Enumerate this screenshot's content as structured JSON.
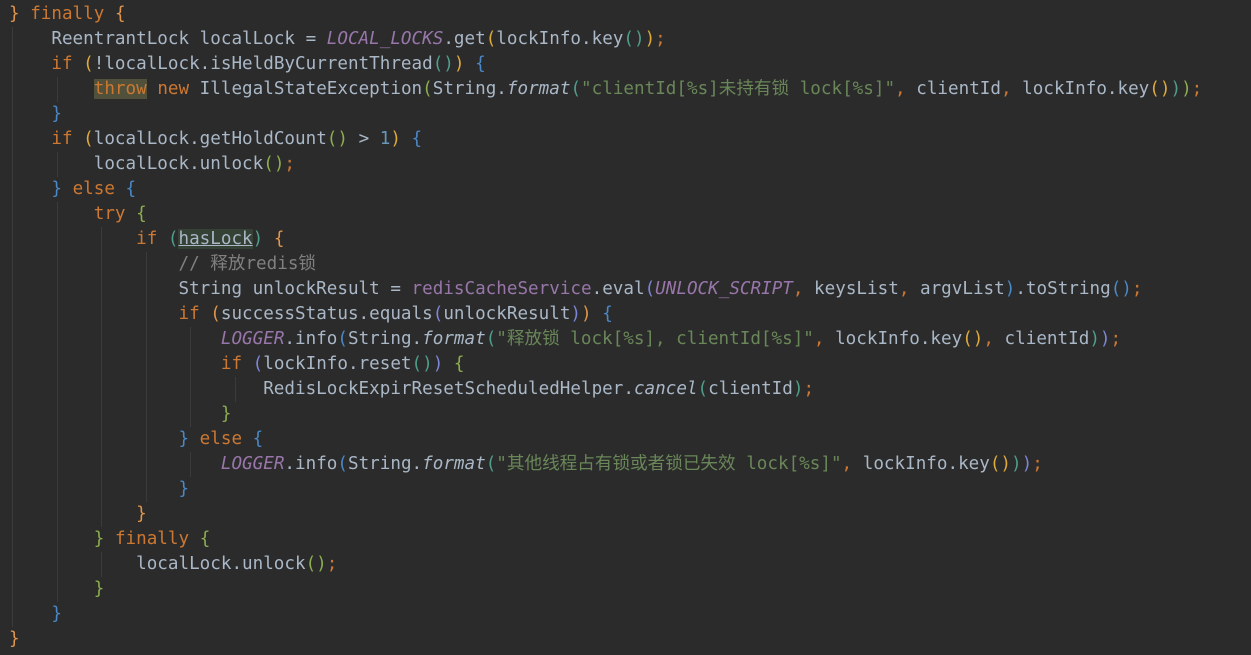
{
  "editor": {
    "theme_colors": {
      "background": "#2b2b2b",
      "keyword": "#cc7832",
      "identifier": "#a9b7c6",
      "constant": "#9876aa",
      "string": "#6a8759",
      "comment": "#808080",
      "number": "#6897bb"
    },
    "lines": [
      {
        "indent": 0,
        "tokens": [
          [
            "b-or",
            "}"
          ],
          [
            "id",
            " "
          ],
          [
            "kw",
            "finally"
          ],
          [
            "id",
            " "
          ],
          [
            "b-or",
            "{"
          ]
        ]
      },
      {
        "indent": 1,
        "tokens": [
          [
            "id",
            "ReentrantLock localLock = "
          ],
          [
            "cst",
            "LOCAL_LOCKS"
          ],
          [
            "id",
            ".get"
          ],
          [
            "b-ye",
            "("
          ],
          [
            "id",
            "lockInfo.key"
          ],
          [
            "b-tl",
            "()"
          ],
          [
            "b-ye",
            ")"
          ],
          [
            "pun",
            ";"
          ]
        ]
      },
      {
        "indent": 1,
        "tokens": [
          [
            "kw",
            "if"
          ],
          [
            "id",
            " "
          ],
          [
            "b-ye",
            "("
          ],
          [
            "id",
            "!localLock.isHeldByCurrentThread"
          ],
          [
            "b-tl",
            "()"
          ],
          [
            "b-ye",
            ")"
          ],
          [
            "id",
            " "
          ],
          [
            "b-bl",
            "{"
          ]
        ]
      },
      {
        "indent": 2,
        "tokens": [
          [
            "kw hl-throw",
            "throw"
          ],
          [
            "id",
            " "
          ],
          [
            "kw",
            "new"
          ],
          [
            "id",
            " IllegalStateException"
          ],
          [
            "b-gr",
            "("
          ],
          [
            "id",
            "String."
          ],
          [
            "ital",
            "format"
          ],
          [
            "b-tl",
            "("
          ],
          [
            "str",
            "\"clientId[%s]未持有锁 lock[%s]\""
          ],
          [
            "pun",
            ","
          ],
          [
            "id",
            " clientId"
          ],
          [
            "pun",
            ","
          ],
          [
            "id",
            " lockInfo.key"
          ],
          [
            "b-ye",
            "()"
          ],
          [
            "b-tl",
            ")"
          ],
          [
            "b-gr",
            ")"
          ],
          [
            "pun",
            ";"
          ]
        ]
      },
      {
        "indent": 1,
        "tokens": [
          [
            "b-bl",
            "}"
          ]
        ]
      },
      {
        "indent": 1,
        "tokens": [
          [
            "kw",
            "if"
          ],
          [
            "id",
            " "
          ],
          [
            "b-ye",
            "("
          ],
          [
            "id",
            "localLock.getHoldCount"
          ],
          [
            "b-gr",
            "()"
          ],
          [
            "id",
            " > "
          ],
          [
            "num",
            "1"
          ],
          [
            "b-ye",
            ")"
          ],
          [
            "id",
            " "
          ],
          [
            "b-bl",
            "{"
          ]
        ]
      },
      {
        "indent": 2,
        "tokens": [
          [
            "id",
            "localLock.unlock"
          ],
          [
            "b-gr",
            "()"
          ],
          [
            "pun",
            ";"
          ]
        ]
      },
      {
        "indent": 1,
        "tokens": [
          [
            "b-bl",
            "}"
          ],
          [
            "id",
            " "
          ],
          [
            "kw",
            "else"
          ],
          [
            "id",
            " "
          ],
          [
            "b-bl",
            "{"
          ]
        ]
      },
      {
        "indent": 2,
        "tokens": [
          [
            "kw",
            "try"
          ],
          [
            "id",
            " "
          ],
          [
            "b-gr",
            "{"
          ]
        ]
      },
      {
        "indent": 3,
        "tokens": [
          [
            "kw",
            "if"
          ],
          [
            "id",
            " "
          ],
          [
            "b-tl",
            "("
          ],
          [
            "id hl-var",
            "hasLock"
          ],
          [
            "b-tl",
            ")"
          ],
          [
            "id",
            " "
          ],
          [
            "b-or",
            "{"
          ]
        ]
      },
      {
        "indent": 4,
        "tokens": [
          [
            "cmt",
            "// 释放redis锁"
          ]
        ]
      },
      {
        "indent": 4,
        "tokens": [
          [
            "id",
            "String unlockResult = "
          ],
          [
            "fld",
            "redisCacheService"
          ],
          [
            "id",
            ".eval"
          ],
          [
            "b-pu",
            "("
          ],
          [
            "cst",
            "UNLOCK_SCRIPT"
          ],
          [
            "pun",
            ","
          ],
          [
            "id",
            " keysList"
          ],
          [
            "pun",
            ","
          ],
          [
            "id",
            " argvList"
          ],
          [
            "b-bl",
            ")"
          ],
          [
            "id",
            ".toString"
          ],
          [
            "b-bl",
            "()"
          ],
          [
            "pun",
            ";"
          ]
        ]
      },
      {
        "indent": 4,
        "tokens": [
          [
            "kw",
            "if"
          ],
          [
            "id",
            " "
          ],
          [
            "b-or",
            "("
          ],
          [
            "id",
            "successStatus.equals"
          ],
          [
            "b-pu",
            "("
          ],
          [
            "id",
            "unlockResult"
          ],
          [
            "b-pu",
            ")"
          ],
          [
            "b-or",
            ")"
          ],
          [
            "id",
            " "
          ],
          [
            "b-bl",
            "{"
          ]
        ]
      },
      {
        "indent": 5,
        "tokens": [
          [
            "cst",
            "LOGGER"
          ],
          [
            "id",
            ".info"
          ],
          [
            "b-bl",
            "("
          ],
          [
            "id",
            "String."
          ],
          [
            "ital",
            "format"
          ],
          [
            "b-tl",
            "("
          ],
          [
            "str",
            "\"释放锁 lock[%s], clientId[%s]\""
          ],
          [
            "pun",
            ","
          ],
          [
            "id",
            " lockInfo.key"
          ],
          [
            "b-ye",
            "()"
          ],
          [
            "pun",
            ","
          ],
          [
            "id",
            " clientId"
          ],
          [
            "b-tl",
            ")"
          ],
          [
            "b-pu",
            ")"
          ],
          [
            "pun",
            ";"
          ]
        ]
      },
      {
        "indent": 5,
        "tokens": [
          [
            "kw",
            "if"
          ],
          [
            "id",
            " "
          ],
          [
            "b-pu",
            "("
          ],
          [
            "id",
            "lockInfo.reset"
          ],
          [
            "b-tl",
            "()"
          ],
          [
            "b-pu",
            ")"
          ],
          [
            "id",
            " "
          ],
          [
            "b-gr",
            "{"
          ]
        ]
      },
      {
        "indent": 6,
        "tokens": [
          [
            "id",
            "RedisLockExpirResetScheduledHelper."
          ],
          [
            "ital",
            "cancel"
          ],
          [
            "b-tl",
            "("
          ],
          [
            "id",
            "clientId"
          ],
          [
            "b-tl",
            ")"
          ],
          [
            "pun",
            ";"
          ]
        ]
      },
      {
        "indent": 5,
        "tokens": [
          [
            "b-gr",
            "}"
          ]
        ]
      },
      {
        "indent": 4,
        "tokens": [
          [
            "b-bl",
            "}"
          ],
          [
            "id",
            " "
          ],
          [
            "kw",
            "else"
          ],
          [
            "id",
            " "
          ],
          [
            "b-bl",
            "{"
          ]
        ]
      },
      {
        "indent": 5,
        "tokens": [
          [
            "cst",
            "LOGGER"
          ],
          [
            "id",
            ".info"
          ],
          [
            "b-bl",
            "("
          ],
          [
            "id",
            "String."
          ],
          [
            "ital",
            "format"
          ],
          [
            "b-tl",
            "("
          ],
          [
            "str",
            "\"其他线程占有锁或者锁已失效 lock[%s]\""
          ],
          [
            "pun",
            ","
          ],
          [
            "id",
            " lockInfo.key"
          ],
          [
            "b-ye",
            "()"
          ],
          [
            "b-tl",
            ")"
          ],
          [
            "b-pu",
            ")"
          ],
          [
            "pun",
            ";"
          ]
        ]
      },
      {
        "indent": 4,
        "tokens": [
          [
            "b-bl",
            "}"
          ]
        ]
      },
      {
        "indent": 3,
        "tokens": [
          [
            "b-or",
            "}"
          ]
        ]
      },
      {
        "indent": 2,
        "tokens": [
          [
            "b-gr",
            "}"
          ],
          [
            "id",
            " "
          ],
          [
            "kw",
            "finally"
          ],
          [
            "id",
            " "
          ],
          [
            "b-gr",
            "{"
          ]
        ]
      },
      {
        "indent": 3,
        "tokens": [
          [
            "id",
            "localLock.unlock"
          ],
          [
            "b-gr",
            "()"
          ],
          [
            "pun",
            ";"
          ]
        ]
      },
      {
        "indent": 2,
        "tokens": [
          [
            "b-gr",
            "}"
          ]
        ]
      },
      {
        "indent": 1,
        "tokens": [
          [
            "b-bl",
            "}"
          ]
        ]
      },
      {
        "indent": 0,
        "tokens": [
          [
            "b-or",
            "}"
          ]
        ]
      }
    ]
  }
}
